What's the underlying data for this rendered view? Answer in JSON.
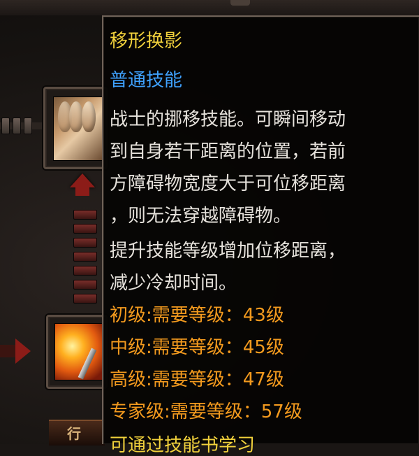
{
  "skill_tooltip": {
    "name": "移形换影",
    "type": "普通技能",
    "description": [
      "战士的挪移技能。可瞬间移动",
      "到自身若干距离的位置，若前",
      "方障碍物宽度大于可位移距离",
      "，则无法穿越障碍物。",
      "提升技能等级增加位移距离，",
      "减少冷却时间。"
    ],
    "requirements": [
      "初级:需要等级：43级",
      "中级:需要等级：45级",
      "高级:需要等级：47级",
      "专家级:需要等级：57级"
    ],
    "footer_cut": "可通过技能书学习"
  },
  "skill_tree": {
    "skills": [
      {
        "icon": "mask-trio-icon"
      },
      {
        "icon": "fire-blade-icon"
      }
    ],
    "bottom_glyph": "行"
  },
  "colors": {
    "name": "#f2d23c",
    "type": "#3fa2ff",
    "description": "#e6e2dc",
    "requirement": "#f39a1e",
    "connector_red": "#8c1c18"
  }
}
